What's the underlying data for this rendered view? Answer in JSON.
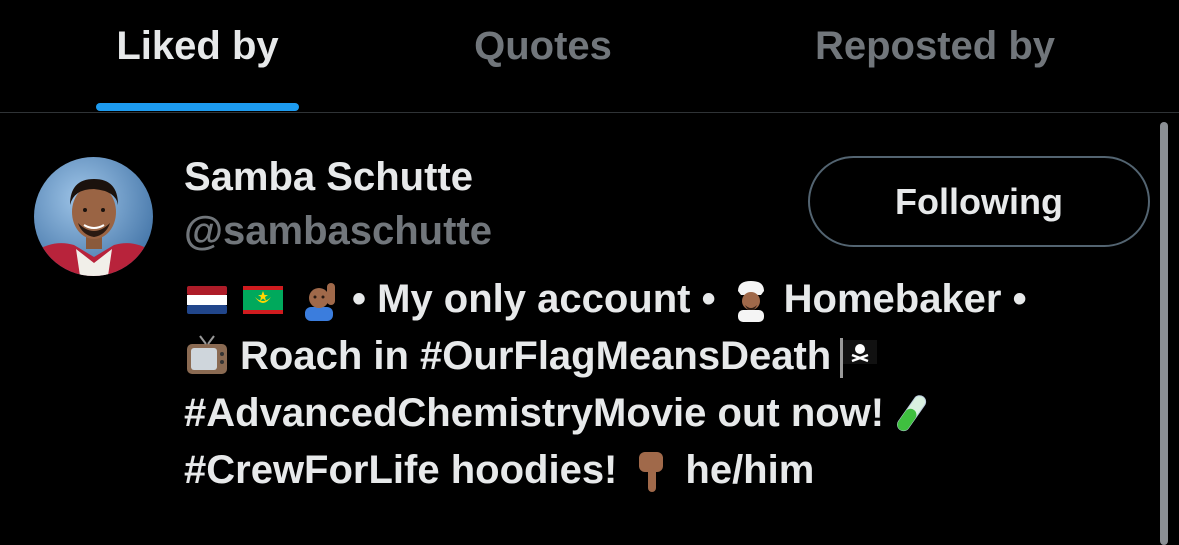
{
  "tabs": [
    {
      "label": "Liked by",
      "active": true
    },
    {
      "label": "Quotes",
      "active": false
    },
    {
      "label": "Reposted by",
      "active": false
    }
  ],
  "user": {
    "name": "Samba Schutte",
    "handle": "@sambaschutte",
    "follow_button": "Following",
    "bio": {
      "line1_text": "• My only account •",
      "line1_tail": "Homebaker •",
      "line2_text": "Roach in #OurFlagMeansDeath",
      "line3_text": "#AdvancedChemistryMovie out now!",
      "line4_text": "#CrewForLife hoodies!",
      "line4_tail": "he/him"
    },
    "bio_icons": [
      "netherlands-flag-icon",
      "mauritania-flag-icon",
      "raising-hand-icon",
      "cook-icon",
      "television-icon",
      "pirate-flag-icon",
      "test-tube-icon",
      "pointing-down-icon"
    ]
  },
  "colors": {
    "background": "#000000",
    "primary_text": "#e7e9ea",
    "secondary_text": "#71767b",
    "accent": "#1d9bf0",
    "divider": "#2f3336",
    "button_border": "#536471"
  }
}
